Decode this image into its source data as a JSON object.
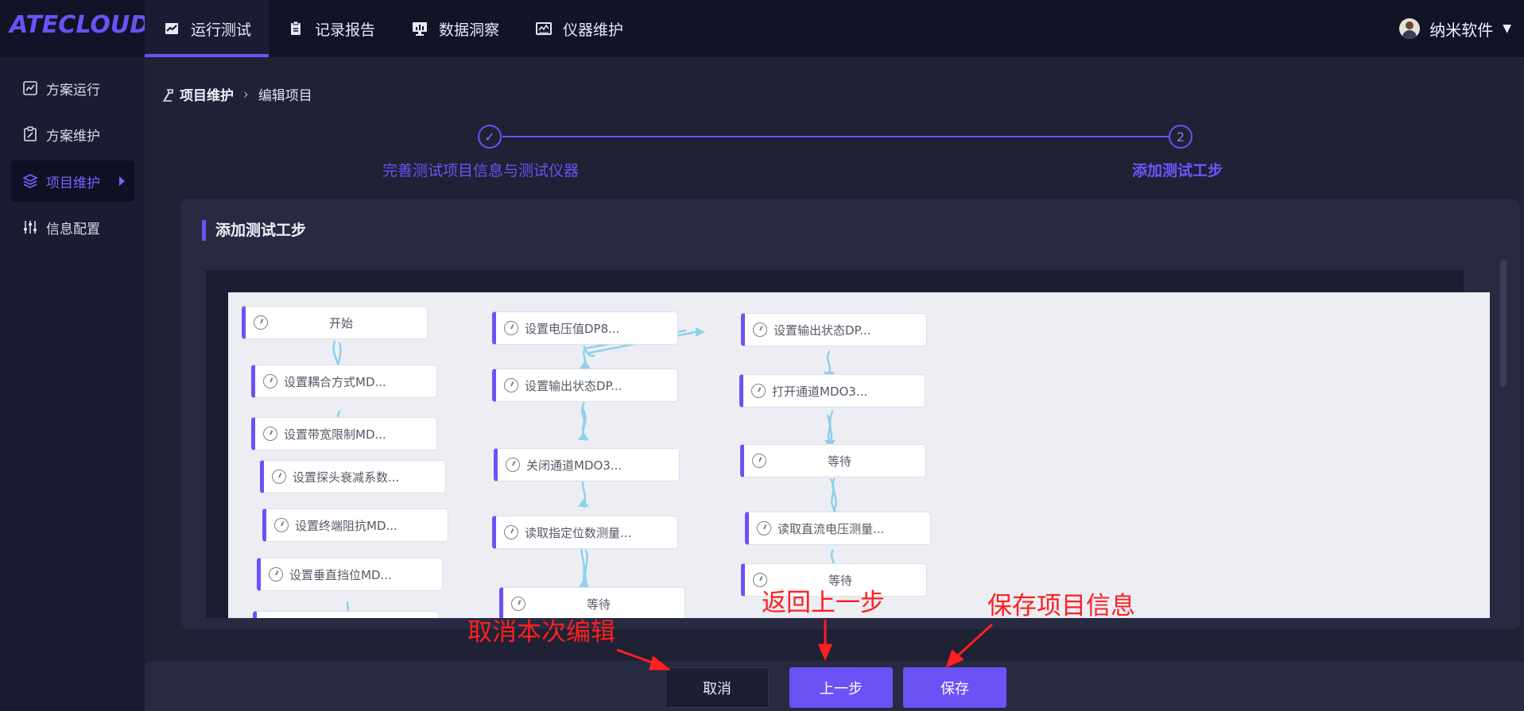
{
  "app": {
    "logo": "ATECLOUD"
  },
  "topnav": {
    "items": [
      {
        "label": "运行测试",
        "icon": "line-chart-icon",
        "active": true
      },
      {
        "label": "记录报告",
        "icon": "clipboard-icon",
        "active": false
      },
      {
        "label": "数据洞察",
        "icon": "monitor-chart-icon",
        "active": false
      },
      {
        "label": "仪器维护",
        "icon": "instrument-icon",
        "active": false
      }
    ],
    "user": {
      "name": "纳米软件",
      "icon": "chevron-down-icon"
    }
  },
  "sidebar": {
    "items": [
      {
        "label": "方案运行",
        "icon": "chart-icon",
        "active": false
      },
      {
        "label": "方案维护",
        "icon": "edit-doc-icon",
        "active": false
      },
      {
        "label": "项目维护",
        "icon": "layers-icon",
        "active": true
      },
      {
        "label": "信息配置",
        "icon": "sliders-icon",
        "active": false
      }
    ]
  },
  "breadcrumb": {
    "home": "项目维护",
    "current": "编辑项目"
  },
  "steps": [
    {
      "label": "完善测试项目信息与测试仪器",
      "marker": "✓"
    },
    {
      "label": "添加测试工步",
      "marker": "2"
    }
  ],
  "section": {
    "title": "添加测试工步"
  },
  "flow": {
    "col1": [
      "开始",
      "设置耦合方式MD...",
      "设置带宽限制MD...",
      "设置探头衰减系数...",
      "设置终端阻抗MD...",
      "设置垂直挡位MD..."
    ],
    "col2": [
      "设置电压值DP8...",
      "设置输出状态DP...",
      "关闭通道MDO3...",
      "读取指定位数测量...",
      "等待"
    ],
    "col3": [
      "设置输出状态DP...",
      "打开通道MDO3...",
      "等待",
      "读取直流电压测量...",
      "等待"
    ]
  },
  "annotations": {
    "cancel": "取消本次编辑",
    "prev": "返回上一步",
    "save": "保存项目信息"
  },
  "footer": {
    "cancel": "取消",
    "prev": "上一步",
    "save": "保存"
  },
  "colors": {
    "accent": "#6b52f5",
    "annotation": "#ff1f1f",
    "link": "#8fd0ec"
  }
}
